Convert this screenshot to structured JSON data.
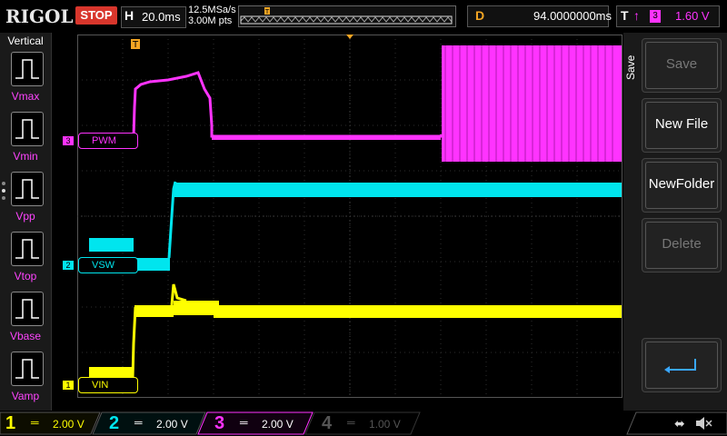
{
  "header": {
    "brand": "RIGOL",
    "run_state": "STOP",
    "timebase_label": "H",
    "timebase_value": "20.0ms",
    "sample_rate": "12.5MSa/s",
    "memory_depth": "3.00M pts",
    "delay_label": "D",
    "delay_value": "94.0000000ms",
    "trigger_label": "T",
    "trigger_channel": "3",
    "trigger_level": "1.60 V"
  },
  "left_menu": {
    "title": "Vertical",
    "items": [
      {
        "label": "Vmax"
      },
      {
        "label": "Vmin"
      },
      {
        "label": "Vpp"
      },
      {
        "label": "Vtop"
      },
      {
        "label": "Vbase"
      },
      {
        "label": "Vamp"
      }
    ]
  },
  "right_menu": {
    "title": "Save",
    "buttons": [
      {
        "label": "Save",
        "enabled": false
      },
      {
        "label": "New File",
        "enabled": true
      },
      {
        "label": "NewFolder",
        "enabled": true
      },
      {
        "label": "Delete",
        "enabled": false
      }
    ],
    "enter_icon": "enter-arrow-icon"
  },
  "channels": [
    {
      "num": "1",
      "scale": "2.00 V",
      "label": "VIN",
      "color": "#ffff00"
    },
    {
      "num": "2",
      "scale": "2.00 V",
      "label": "VSW",
      "color": "#00e5ee"
    },
    {
      "num": "3",
      "scale": "2.00 V",
      "label": "PWM",
      "color": "#ff33ff"
    },
    {
      "num": "4",
      "scale": "1.00 V",
      "label": "",
      "color": "#3a6fd8"
    }
  ],
  "status_icons": [
    "usb-icon",
    "speaker-mute-icon"
  ],
  "colors": {
    "ch1": "#ffff00",
    "ch2": "#00e5ee",
    "ch3": "#ff33ff",
    "trigger_marker": "#f5a623",
    "stop": "#d8362c"
  }
}
